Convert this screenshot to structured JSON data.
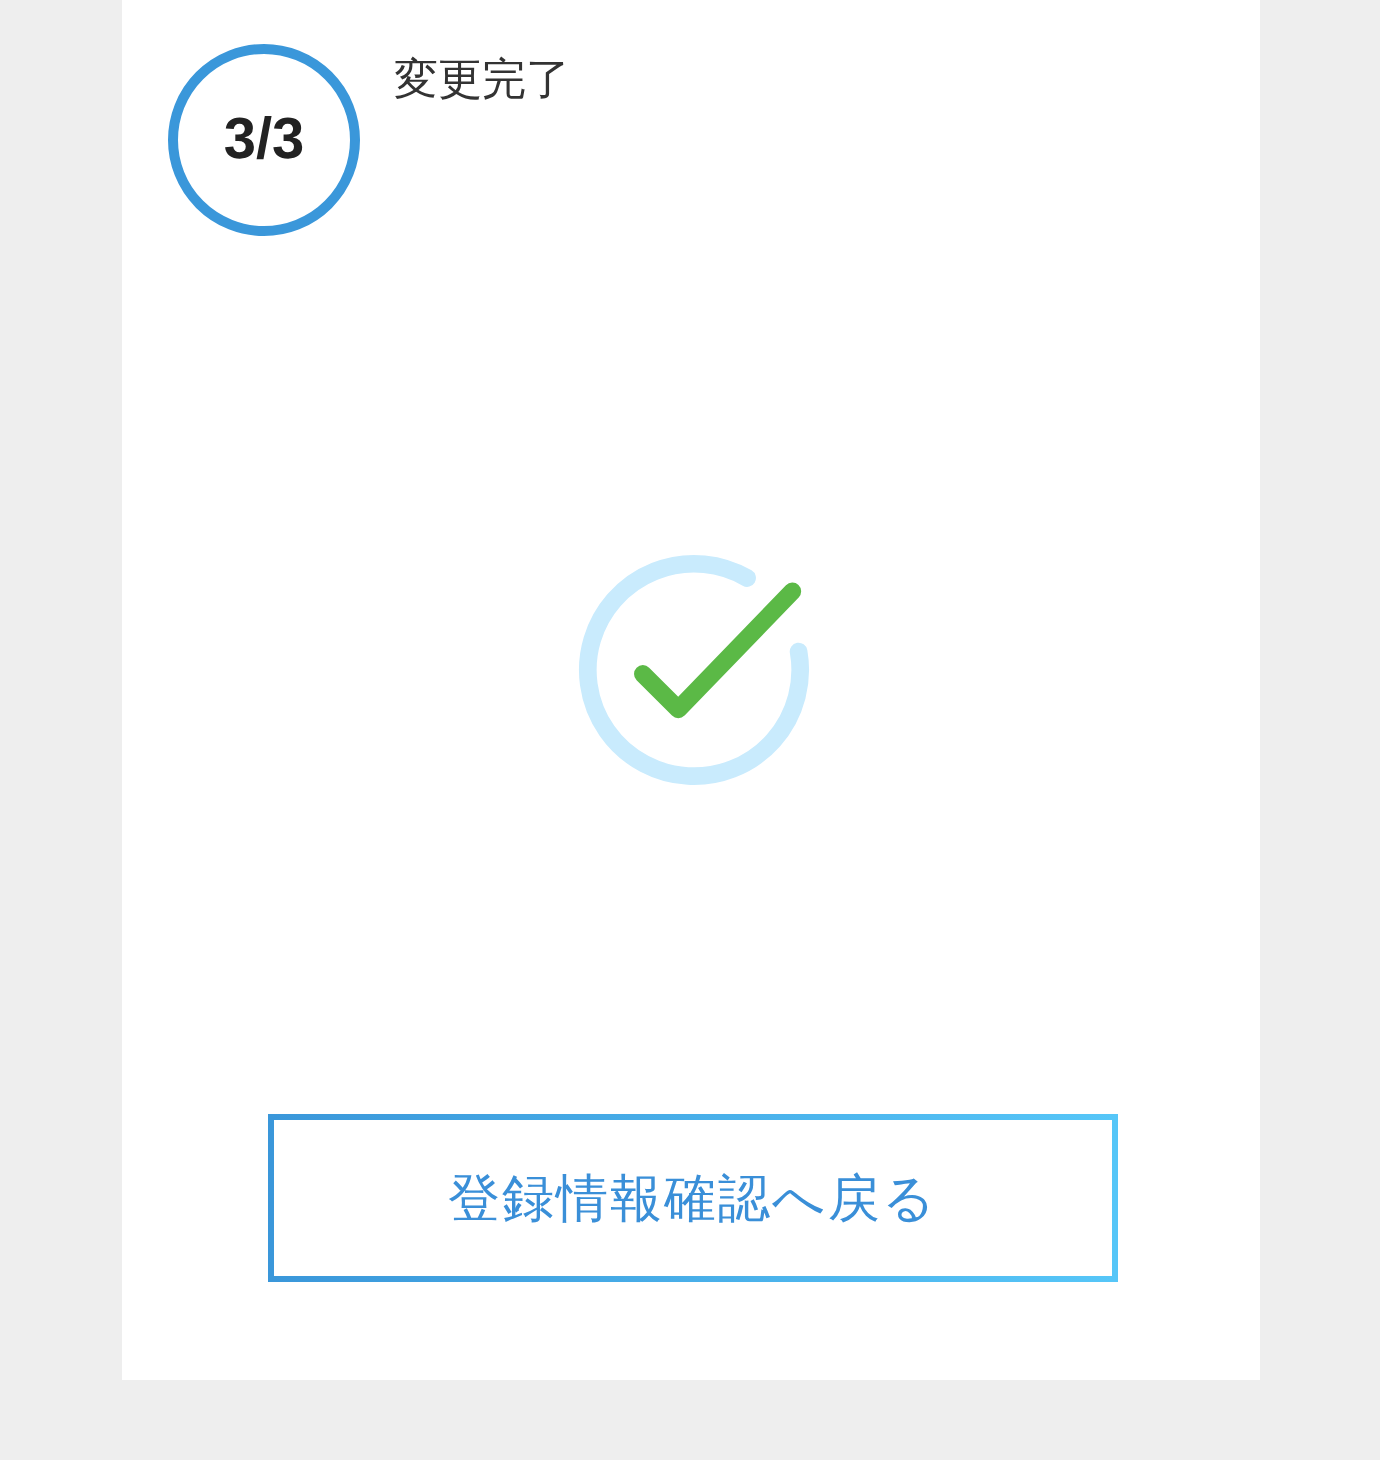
{
  "step": {
    "label": "3/3"
  },
  "title": "変更完了",
  "button": {
    "label": "登録情報確認へ戻る"
  }
}
